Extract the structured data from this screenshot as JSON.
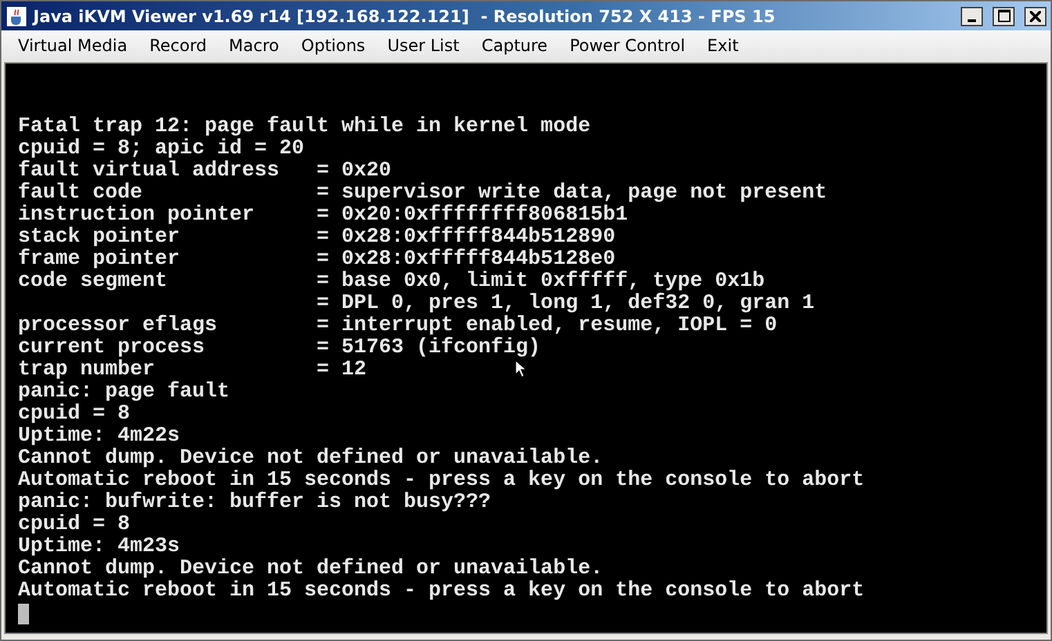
{
  "window": {
    "title": "Java iKVM Viewer v1.69 r14 [192.168.122.121]  - Resolution 752 X 413 - FPS 15"
  },
  "menu": [
    "Virtual Media",
    "Record",
    "Macro",
    "Options",
    "User List",
    "Capture",
    "Power Control",
    "Exit"
  ],
  "console": {
    "lines": [
      "Fatal trap 12: page fault while in kernel mode",
      "cpuid = 8; apic id = 20",
      "fault virtual address   = 0x20",
      "fault code              = supervisor write data, page not present",
      "instruction pointer     = 0x20:0xffffffff806815b1",
      "stack pointer           = 0x28:0xfffff844b512890",
      "frame pointer           = 0x28:0xfffff844b5128e0",
      "code segment            = base 0x0, limit 0xfffff, type 0x1b",
      "                        = DPL 0, pres 1, long 1, def32 0, gran 1",
      "processor eflags        = interrupt enabled, resume, IOPL = 0",
      "current process         = 51763 (ifconfig)",
      "trap number             = 12",
      "panic: page fault",
      "cpuid = 8",
      "Uptime: 4m22s",
      "Cannot dump. Device not defined or unavailable.",
      "Automatic reboot in 15 seconds - press a key on the console to abort",
      "panic: bufwrite: buffer is not busy???",
      "cpuid = 8",
      "Uptime: 4m23s",
      "Cannot dump. Device not defined or unavailable.",
      "Automatic reboot in 15 seconds - press a key on the console to abort"
    ]
  }
}
